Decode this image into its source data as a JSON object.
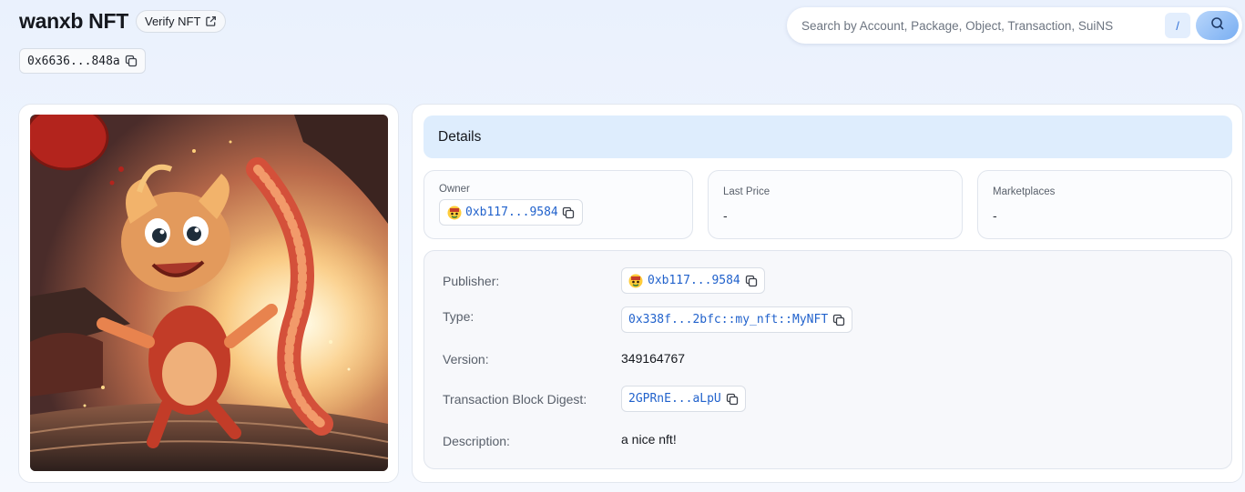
{
  "header": {
    "title": "wanxb NFT",
    "verify_label": "Verify NFT",
    "object_id_short": "0x6636...848a"
  },
  "search": {
    "placeholder": "Search by Account, Package, Object, Transaction, SuiNS",
    "shortcut": "/"
  },
  "details": {
    "heading": "Details",
    "owner_label": "Owner",
    "owner_value": "0xb117...9584",
    "last_price_label": "Last Price",
    "last_price_value": "-",
    "marketplaces_label": "Marketplaces",
    "marketplaces_value": "-"
  },
  "properties": {
    "publisher_label": "Publisher:",
    "publisher_value": "0xb117...9584",
    "type_label": "Type:",
    "type_value": "0x338f...2bfc::my_nft::MyNFT",
    "version_label": "Version:",
    "version_value": "349164767",
    "digest_label": "Transaction Block Digest:",
    "digest_value": "2GPRnE...aLpU",
    "description_label": "Description:",
    "description_value": "a nice nft!"
  },
  "icons": [
    "external-link-icon",
    "copy-icon",
    "search-icon",
    "avatar-icon"
  ],
  "colors": {
    "accent": "#2162cc",
    "header_bg": "#deedfd",
    "search_button": "#78aef2"
  }
}
